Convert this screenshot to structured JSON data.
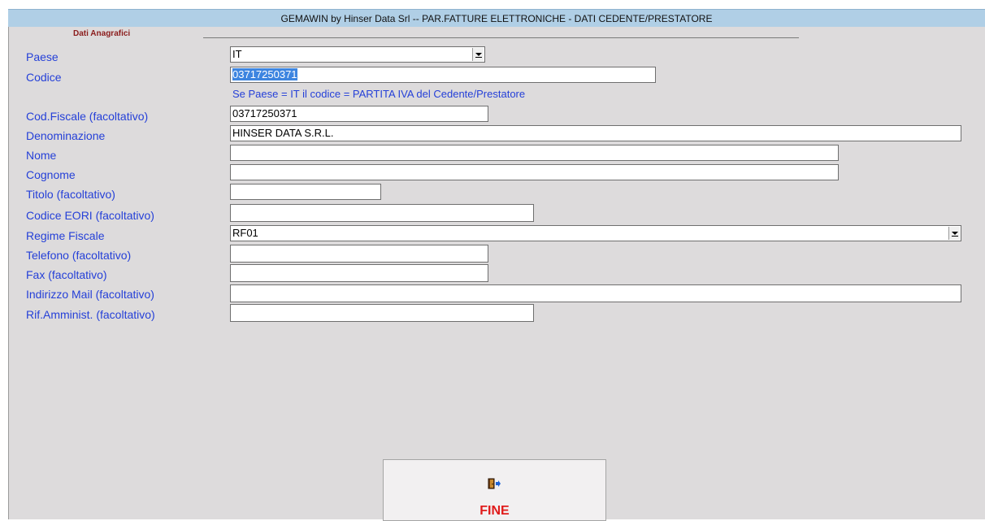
{
  "window": {
    "title": "GEMAWIN by Hinser Data Srl -- PAR.FATTURE ELETTRONICHE - DATI CEDENTE/PRESTATORE"
  },
  "section": {
    "title": "Dati Anagrafici"
  },
  "hint": "Se Paese = IT il codice = PARTITA IVA del Cedente/Prestatore",
  "fields": {
    "paese": {
      "label": "Paese",
      "value": "IT"
    },
    "codice": {
      "label": "Codice",
      "value": "03717250371"
    },
    "cod_fiscale": {
      "label": "Cod.Fiscale (facoltativo)",
      "value": "03717250371"
    },
    "denominazione": {
      "label": "Denominazione",
      "value": "HINSER DATA S.R.L."
    },
    "nome": {
      "label": "Nome",
      "value": ""
    },
    "cognome": {
      "label": "Cognome",
      "value": ""
    },
    "titolo": {
      "label": "Titolo (facoltativo)",
      "value": ""
    },
    "codice_eori": {
      "label": "Codice EORI (facoltativo)",
      "value": ""
    },
    "regime_fiscale": {
      "label": "Regime Fiscale",
      "value": "RF01"
    },
    "telefono": {
      "label": "Telefono (facoltativo)",
      "value": ""
    },
    "fax": {
      "label": "Fax (facoltativo)",
      "value": ""
    },
    "indirizzo_mail": {
      "label": "Indirizzo Mail (facoltativo)",
      "value": ""
    },
    "rif_amminist": {
      "label": "Rif.Amminist. (facoltativo)",
      "value": ""
    }
  },
  "buttons": {
    "fine_label": "FINE"
  },
  "icons": {
    "fine": "exit-door-icon"
  },
  "colors": {
    "titlebar": "#b0cfe6",
    "background": "#dddbdc",
    "label": "#2540d8",
    "section_title": "#8b1c1c",
    "fine_label": "#e01b1b",
    "selection": "#3d85e0"
  }
}
